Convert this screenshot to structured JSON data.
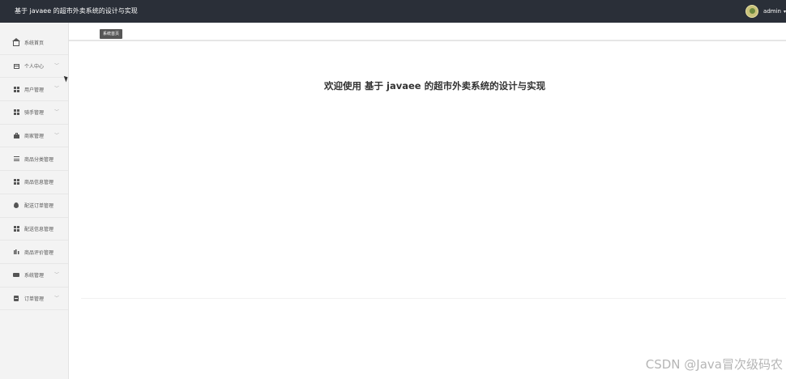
{
  "header": {
    "app_title": "基于 javaee 的超市外卖系统的设计与实现",
    "user_name": "admin",
    "caret": "▾"
  },
  "sidebar": {
    "items": [
      {
        "label": "系统首页",
        "icon": "home-icon",
        "has_chevron": false
      },
      {
        "label": "个人中心",
        "icon": "profile-icon",
        "has_chevron": true
      },
      {
        "label": "用户管理",
        "icon": "grid-icon",
        "has_chevron": true
      },
      {
        "label": "骑手管理",
        "icon": "grid-icon",
        "has_chevron": true
      },
      {
        "label": "商家管理",
        "icon": "shop-icon",
        "has_chevron": true
      },
      {
        "label": "商品分类管理",
        "icon": "list-icon",
        "has_chevron": false
      },
      {
        "label": "商品信息管理",
        "icon": "grid-icon",
        "has_chevron": false
      },
      {
        "label": "配送订单管理",
        "icon": "pin-icon",
        "has_chevron": false
      },
      {
        "label": "配送信息管理",
        "icon": "grid-icon",
        "has_chevron": false
      },
      {
        "label": "商品评价管理",
        "icon": "bar-chart-icon",
        "has_chevron": false
      },
      {
        "label": "系统管理",
        "icon": "ticket-icon",
        "has_chevron": true
      },
      {
        "label": "订单管理",
        "icon": "clipboard-icon",
        "has_chevron": true
      }
    ],
    "chevron": "﹀"
  },
  "breadcrumb": {
    "current": "系统首页"
  },
  "main": {
    "welcome_text": "欢迎使用 基于 javaee 的超市外卖系统的设计与实现"
  },
  "watermark": "CSDN @Java冒次级码农"
}
